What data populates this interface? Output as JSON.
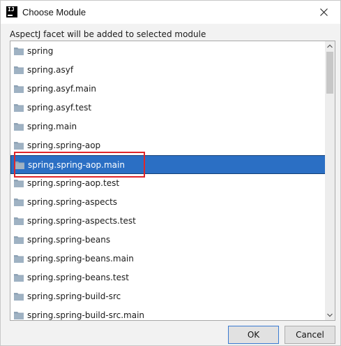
{
  "window": {
    "title": "Choose Module",
    "app_icon_text": "IJ",
    "close_icon": "close-icon"
  },
  "caption": "AspectJ facet will be added to selected module",
  "modules": [
    {
      "name": "spring",
      "selected": false
    },
    {
      "name": "spring.asyf",
      "selected": false
    },
    {
      "name": "spring.asyf.main",
      "selected": false
    },
    {
      "name": "spring.asyf.test",
      "selected": false
    },
    {
      "name": "spring.main",
      "selected": false
    },
    {
      "name": "spring.spring-aop",
      "selected": false
    },
    {
      "name": "spring.spring-aop.main",
      "selected": true
    },
    {
      "name": "spring.spring-aop.test",
      "selected": false
    },
    {
      "name": "spring.spring-aspects",
      "selected": false
    },
    {
      "name": "spring.spring-aspects.test",
      "selected": false
    },
    {
      "name": "spring.spring-beans",
      "selected": false
    },
    {
      "name": "spring.spring-beans.main",
      "selected": false
    },
    {
      "name": "spring.spring-beans.test",
      "selected": false
    },
    {
      "name": "spring.spring-build-src",
      "selected": false
    },
    {
      "name": "spring.spring-build-src.main",
      "selected": false
    }
  ],
  "buttons": {
    "ok": "OK",
    "cancel": "Cancel"
  },
  "colors": {
    "selection": "#2b6fc4",
    "annotation": "#e0262a",
    "folder": "#8fa3b5"
  }
}
